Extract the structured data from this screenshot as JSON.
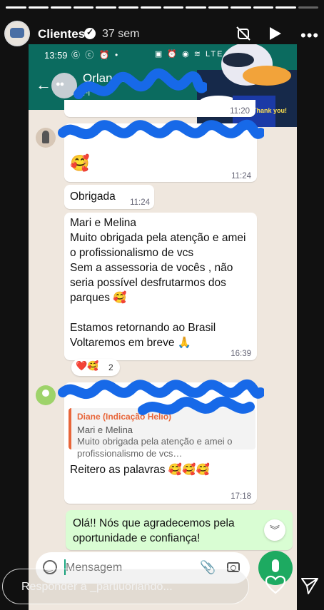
{
  "story": {
    "title": "Clientes",
    "time_ago": "37 sem",
    "segments_total": 14,
    "segments_done": 13,
    "icons": [
      "verified-badge-icon",
      "mute-icon",
      "play-icon",
      "more-icon"
    ]
  },
  "phone": {
    "status_time": "13:59",
    "status_icons": "Ⓖ ⓒ ⏰ •",
    "status_right": "▣ ⏰ ◉ ≋ LTE ▴",
    "chat_name": "Orlando -",
    "chat_subtitle": "Fl",
    "sticker_text": "Thank you!"
  },
  "messages": [
    {
      "id": "m0",
      "time": "11:20"
    },
    {
      "id": "m1",
      "emoji": "🥰",
      "time": "11:24"
    },
    {
      "id": "m2",
      "text": "Obrigada",
      "time": "11:24"
    },
    {
      "id": "m3",
      "text": "Mari e Melina\nMuito obrigada pela atenção e amei o profissionalismo de vcs\nSem a assessoria de vocês , não seria possível desfrutarmos dos parques 🥰\n\nEstamos retornando ao Brasil\nVoltaremos em breve 🙏",
      "time": "16:39"
    },
    {
      "id": "m4",
      "quote_author": "Diane (Indicação Helio)",
      "quote_title": "Mari e Melina",
      "quote_text": "Muito obrigada pela atenção e amei o profissionalismo de vcs…",
      "text": "Reitero as palavras 🥰🥰🥰",
      "time": "17:18"
    },
    {
      "id": "m5",
      "text": "Olá!! Nós que agradecemos pela oportunidade e confiança!"
    }
  ],
  "reactions": {
    "emojis": "❤️🥰",
    "count": "2"
  },
  "composer": {
    "placeholder": "Mensagem"
  },
  "reply": {
    "placeholder": "Responder a _partiuorlando..."
  },
  "colors": {
    "header_teal": "#0b6b5f",
    "outgoing_bubble": "#d9fdd3",
    "mic_green": "#1daa61",
    "scribble_blue": "#1769e8",
    "quote_accent": "#e8663a"
  }
}
